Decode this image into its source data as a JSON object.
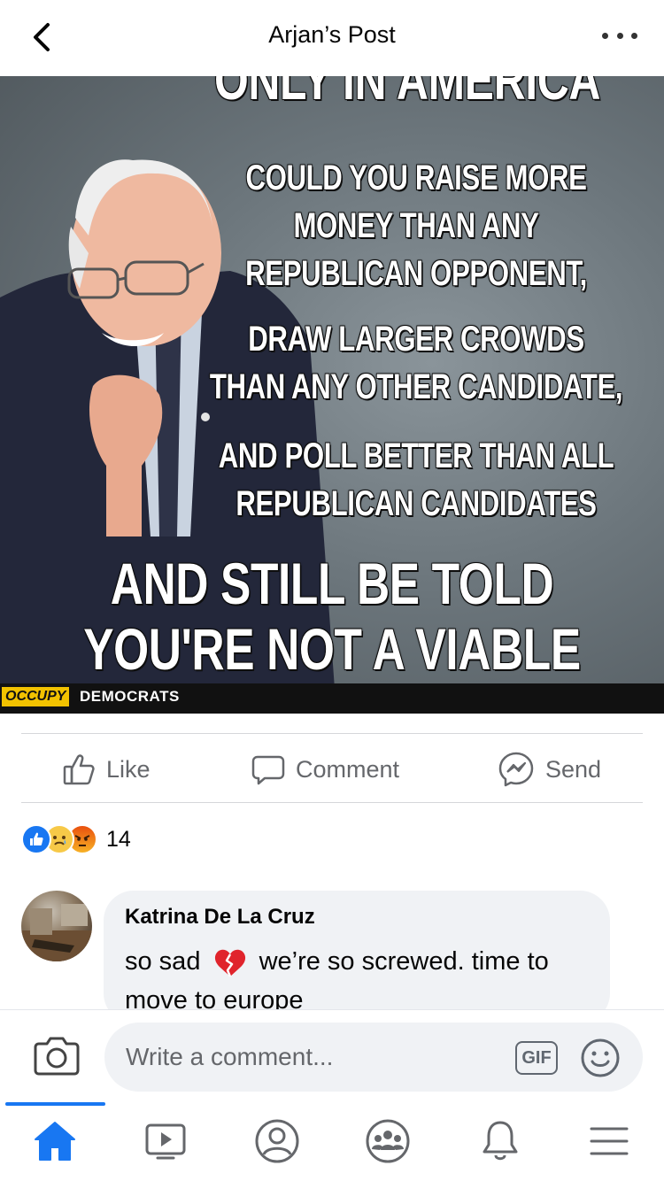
{
  "header": {
    "title": "Arjan’s Post"
  },
  "poster": {
    "headline": "ONLY IN AMERICA",
    "line1": "COULD YOU RAISE MORE MONEY THAN ANY REPUBLICAN OPPONENT,",
    "line2": "DRAW LARGER CROWDS THAN ANY OTHER CANDIDATE,",
    "line3": "AND POLL BETTER THAN ALL REPUBLICAN CANDIDATES",
    "line4": "AND STILL BE TOLD YOU'RE NOT A VIABLE CANDIDATE!",
    "brand_occupy": "OCCUPY",
    "brand_democrats": "DEMOCRATS"
  },
  "actions": {
    "like": "Like",
    "comment": "Comment",
    "send": "Send"
  },
  "reactions": {
    "count": "14",
    "types": [
      "like-icon",
      "sad-icon",
      "angry-icon"
    ]
  },
  "comment": {
    "author": "Katrina De La Cruz",
    "text_before": "so sad",
    "text_after": "we’re so screwed. time to move to europe"
  },
  "composer": {
    "placeholder": "Write a comment...",
    "gif_label": "GIF"
  },
  "nav": {
    "items": [
      "home-icon",
      "video-icon",
      "profile-icon",
      "groups-icon",
      "notifications-icon",
      "menu-icon"
    ],
    "active": "home-icon"
  },
  "colors": {
    "accent": "#1877f2",
    "text_secondary": "#65676b",
    "bubble": "#f0f2f5",
    "brand_yellow": "#f2c200"
  }
}
